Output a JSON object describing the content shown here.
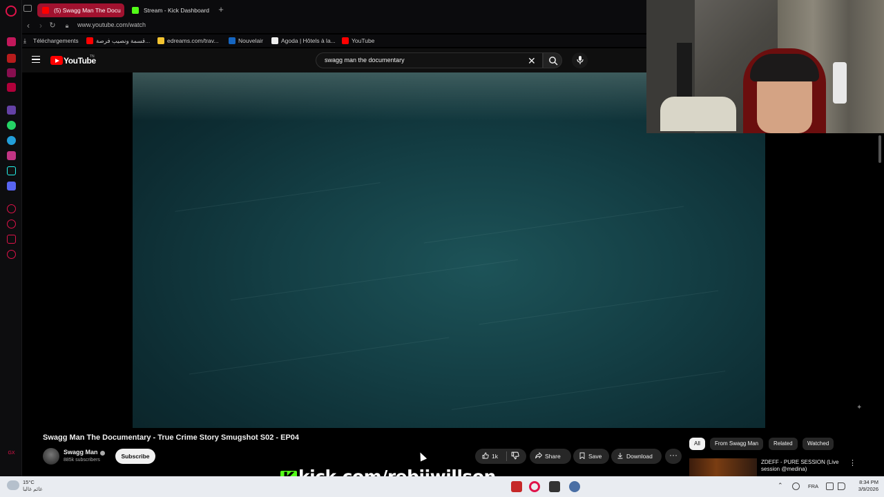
{
  "browser": {
    "tabs": [
      {
        "label": "(5) Swagg Man The Docu",
        "active": true,
        "favicon_color": "#ff0000"
      },
      {
        "label": "Stream - Kick Dashboard",
        "active": false,
        "favicon_color": "#53fc18"
      }
    ],
    "new_tab_symbol": "+",
    "url": "www.youtube.com/watch",
    "bookmarks": [
      {
        "label": "Téléchargements",
        "icon": "download-icon"
      },
      {
        "label": "قسمة ونصيب فرصة...",
        "icon": "youtube-icon"
      },
      {
        "label": "edreams.com/trav...",
        "icon": "edreams-icon"
      },
      {
        "label": "Nouvelair",
        "icon": "nouvelair-icon"
      },
      {
        "label": "Agoda | Hôtels à la...",
        "icon": "agoda-icon"
      },
      {
        "label": "YouTube",
        "icon": "youtube-icon"
      }
    ]
  },
  "youtube": {
    "logo_text": "YouTube",
    "logo_tm": "TN",
    "search_query": "swagg man the documentary",
    "clear_symbol": "✕",
    "video": {
      "title": "Swagg Man The Documentary - True Crime Story Smugshot S02 - EP04"
    },
    "channel": {
      "name": "Swagg Man",
      "subscribers": "885k subscribers",
      "subscribe_label": "Subscribe"
    },
    "actions": {
      "like_count": "1k",
      "share_label": "Share",
      "save_label": "Save",
      "download_label": "Download",
      "more_symbol": "···"
    },
    "chips": [
      "All",
      "From Swagg Man",
      "Related",
      "Watched"
    ],
    "recommendation": {
      "title": "ZDEFF - PURE SESSION (Live session @medina)",
      "more_symbol": "⋮"
    }
  },
  "overlay": {
    "kick_letter": "K",
    "kick_text": "kick.com/rebiiwillson"
  },
  "taskbar": {
    "temperature": "15°C",
    "weather_text": "غائم غالبا",
    "language": "FRA",
    "time": "8:34 PM",
    "date": "3/9/2026"
  },
  "colors": {
    "accent": "#a1122f",
    "youtube_red": "#ff0000",
    "kick_green": "#53fc18"
  }
}
